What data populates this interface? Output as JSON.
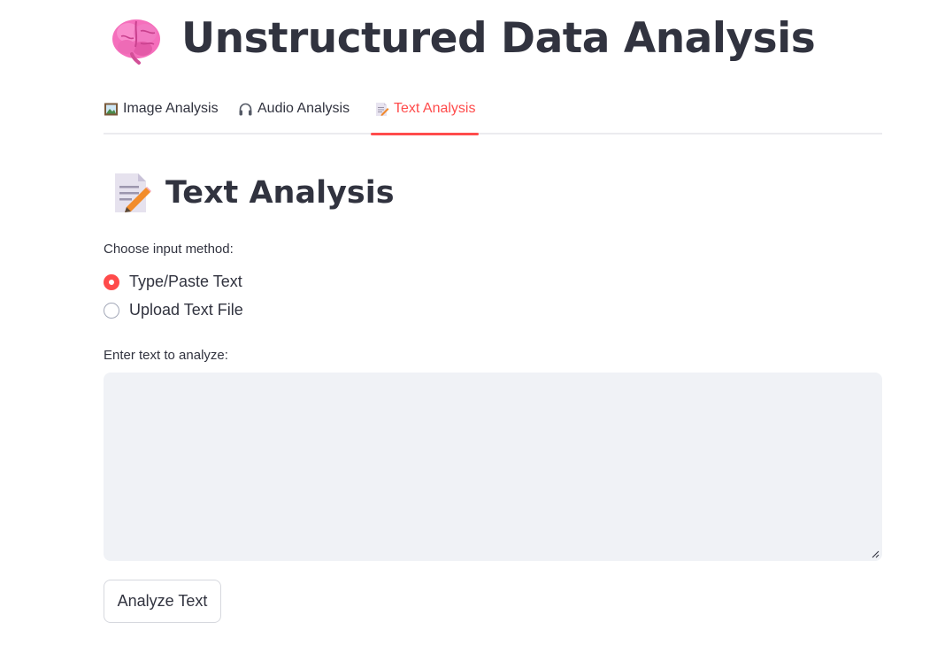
{
  "app": {
    "title": "Unstructured Data Analysis",
    "title_icon": "brain-icon"
  },
  "tabs": [
    {
      "label": "Image Analysis",
      "icon": "framed-picture-icon",
      "active": false
    },
    {
      "label": "Audio Analysis",
      "icon": "headphone-icon",
      "active": false
    },
    {
      "label": "Text Analysis",
      "icon": "memo-icon",
      "active": true
    }
  ],
  "section": {
    "title": "Text Analysis",
    "icon": "memo-icon",
    "input_method": {
      "label": "Choose input method:",
      "options": [
        {
          "label": "Type/Paste Text",
          "selected": true
        },
        {
          "label": "Upload Text File",
          "selected": false
        }
      ]
    },
    "text_input": {
      "label": "Enter text to analyze:",
      "value": "",
      "placeholder": ""
    },
    "analyze_button": "Analyze Text"
  },
  "colors": {
    "accent": "#ff4b4b",
    "text": "#31333f",
    "input_bg": "#f0f2f6"
  }
}
